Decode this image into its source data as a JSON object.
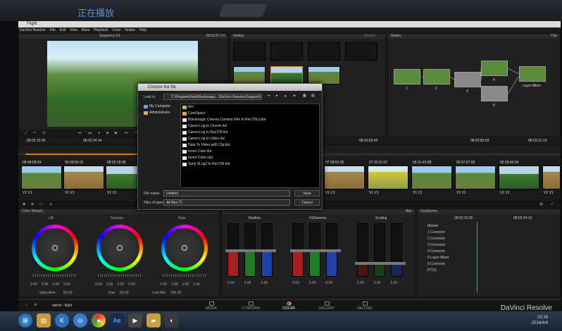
{
  "player_overlay": {
    "status": "正在播放"
  },
  "window": {
    "title": "Flight"
  },
  "menu": [
    "DaVinci Resolve",
    "File",
    "Edit",
    "View",
    "Mark",
    "Playback",
    "Color",
    "Nodes",
    "Help"
  ],
  "viewer": {
    "timecode": "08:03:57:14",
    "title": "Sequence 01"
  },
  "gallery": {
    "title": "Gallery",
    "search_placeholder": "Search"
  },
  "nodes": {
    "title": "Nodes",
    "mode": "Clip",
    "items": [
      {
        "num": "1",
        "label": ""
      },
      {
        "num": "2",
        "label": ""
      },
      {
        "num": "3",
        "label": ""
      },
      {
        "num": "4",
        "label": ""
      },
      {
        "num": "5",
        "label": ""
      },
      {
        "num": "6",
        "label": ""
      },
      {
        "num": "",
        "label": "Layer Mixer"
      }
    ]
  },
  "mini_timeline": {
    "ticks": [
      "08:02:15:05",
      "08:02:24:14",
      "08:02:53:00",
      "08:02:55:03",
      "08:03:12:13"
    ]
  },
  "clips": [
    {
      "tc": "08:48:58:24",
      "label": "V1 V1"
    },
    {
      "tc": "06:59:53:22",
      "label": "V1 V1"
    },
    {
      "tc": "08:02:18:08",
      "label": "V1 V1"
    },
    {
      "tc": "",
      "label": ""
    },
    {
      "tc": "",
      "label": ""
    },
    {
      "tc": "",
      "label": ""
    },
    {
      "tc": "",
      "label": ""
    },
    {
      "tc": "07:38:51:05",
      "label": "V1 V1"
    },
    {
      "tc": "07:32:51:07",
      "label": "V1 V1"
    },
    {
      "tc": "06:31:43:08",
      "label": "V1 V1"
    },
    {
      "tc": "06:37:07:00",
      "label": "V1 V1"
    },
    {
      "tc": "06:38:49:04",
      "label": "V1 V1"
    },
    {
      "tc": "",
      "label": "V1 V1"
    }
  ],
  "color_wheels": {
    "title": "Color Wheels",
    "wheels": [
      {
        "name": "Lift",
        "values": [
          "0.00",
          "0.00",
          "0.00",
          "0.00"
        ]
      },
      {
        "name": "Gamma",
        "values": [
          "0.00",
          "0.00",
          "0.00",
          "0.00"
        ]
      },
      {
        "name": "Gain",
        "values": [
          "1.00",
          "1.00",
          "1.00",
          "1.00"
        ]
      }
    ],
    "saturation_label": "Saturation",
    "saturation": "50.00",
    "hue_label": "Hue",
    "hue": "50.00",
    "lum_mix_label": "Lum Mix",
    "lum_mix": "100.00"
  },
  "curves": {
    "groups": [
      {
        "name": "Redline",
        "values": [
          "0.50",
          "0.50",
          "0.50"
        ]
      },
      {
        "name": "HI/Gamma",
        "values": [
          "0.50",
          "0.50",
          "0.50"
        ]
      },
      {
        "name": "Scaling",
        "values": [
          "0.25",
          "0.25",
          "0.25"
        ]
      }
    ],
    "mode": "Blur"
  },
  "keyframes": {
    "title": "Keyframes",
    "ruler": [
      "08:02:15:05",
      "08:02:24:13"
    ],
    "mode": "Master",
    "rows": [
      {
        "num": "",
        "label": "Master"
      },
      {
        "num": "1",
        "label": "Corrector"
      },
      {
        "num": "2",
        "label": "Corrector"
      },
      {
        "num": "3",
        "label": "Corrector"
      },
      {
        "num": "4",
        "label": "Corrector"
      },
      {
        "num": "5",
        "label": "Layer Mixer"
      },
      {
        "num": "6",
        "label": "Corrector"
      },
      {
        "num": "",
        "label": "PTZ/L"
      }
    ]
  },
  "dialog": {
    "title": "Choose the file",
    "look_in_label": "Look in:",
    "path": "C:\\ProgramData\\Blackmagic...\\DaVinci Resolve\\Support\\LUT",
    "sidebar": [
      "My Computer",
      "Administrator"
    ],
    "items": [
      {
        "type": "folder",
        "name": "Arri"
      },
      {
        "type": "folder",
        "name": "CineSpace"
      },
      {
        "type": "file",
        "name": "Blackmagic Cinema Camera Film to Rec709.cube"
      },
      {
        "type": "file",
        "name": "Canon Log to Cineon.ilut"
      },
      {
        "type": "file",
        "name": "Canon Log to Rec709.ilut"
      },
      {
        "type": "file",
        "name": "Canon Log to Video.ilut"
      },
      {
        "type": "file",
        "name": "Data To Video with Clip.ilut"
      },
      {
        "type": "file",
        "name": "Invert Color.ilut"
      },
      {
        "type": "file",
        "name": "Invert Color.olut"
      },
      {
        "type": "file",
        "name": "Sony SLog2 to Rec709.ilut"
      }
    ],
    "file_name_label": "File name:",
    "file_name": "Untitled",
    "file_type_label": "Files of type:",
    "file_type": "All files (*)",
    "save_label": "Save",
    "cancel_label": "Cancel"
  },
  "pages": [
    {
      "name": "MEDIA",
      "active": false
    },
    {
      "name": "CONFORM",
      "active": false
    },
    {
      "name": "COLOR",
      "active": true
    },
    {
      "name": "GALLERY",
      "active": false
    },
    {
      "name": "DELIVER",
      "active": false
    }
  ],
  "status": {
    "user": "admin : flight",
    "brand": "DaVinci Resolve"
  },
  "taskbar": {
    "icons": [
      "start-icon",
      "explorer-icon",
      "media-player-icon",
      "globe-icon",
      "chrome-icon",
      "photoshop-icon",
      "after-effects-icon",
      "video-icon",
      "folder-icon",
      "resolve-icon"
    ],
    "time": "23:16",
    "date": "2014/4/4"
  }
}
